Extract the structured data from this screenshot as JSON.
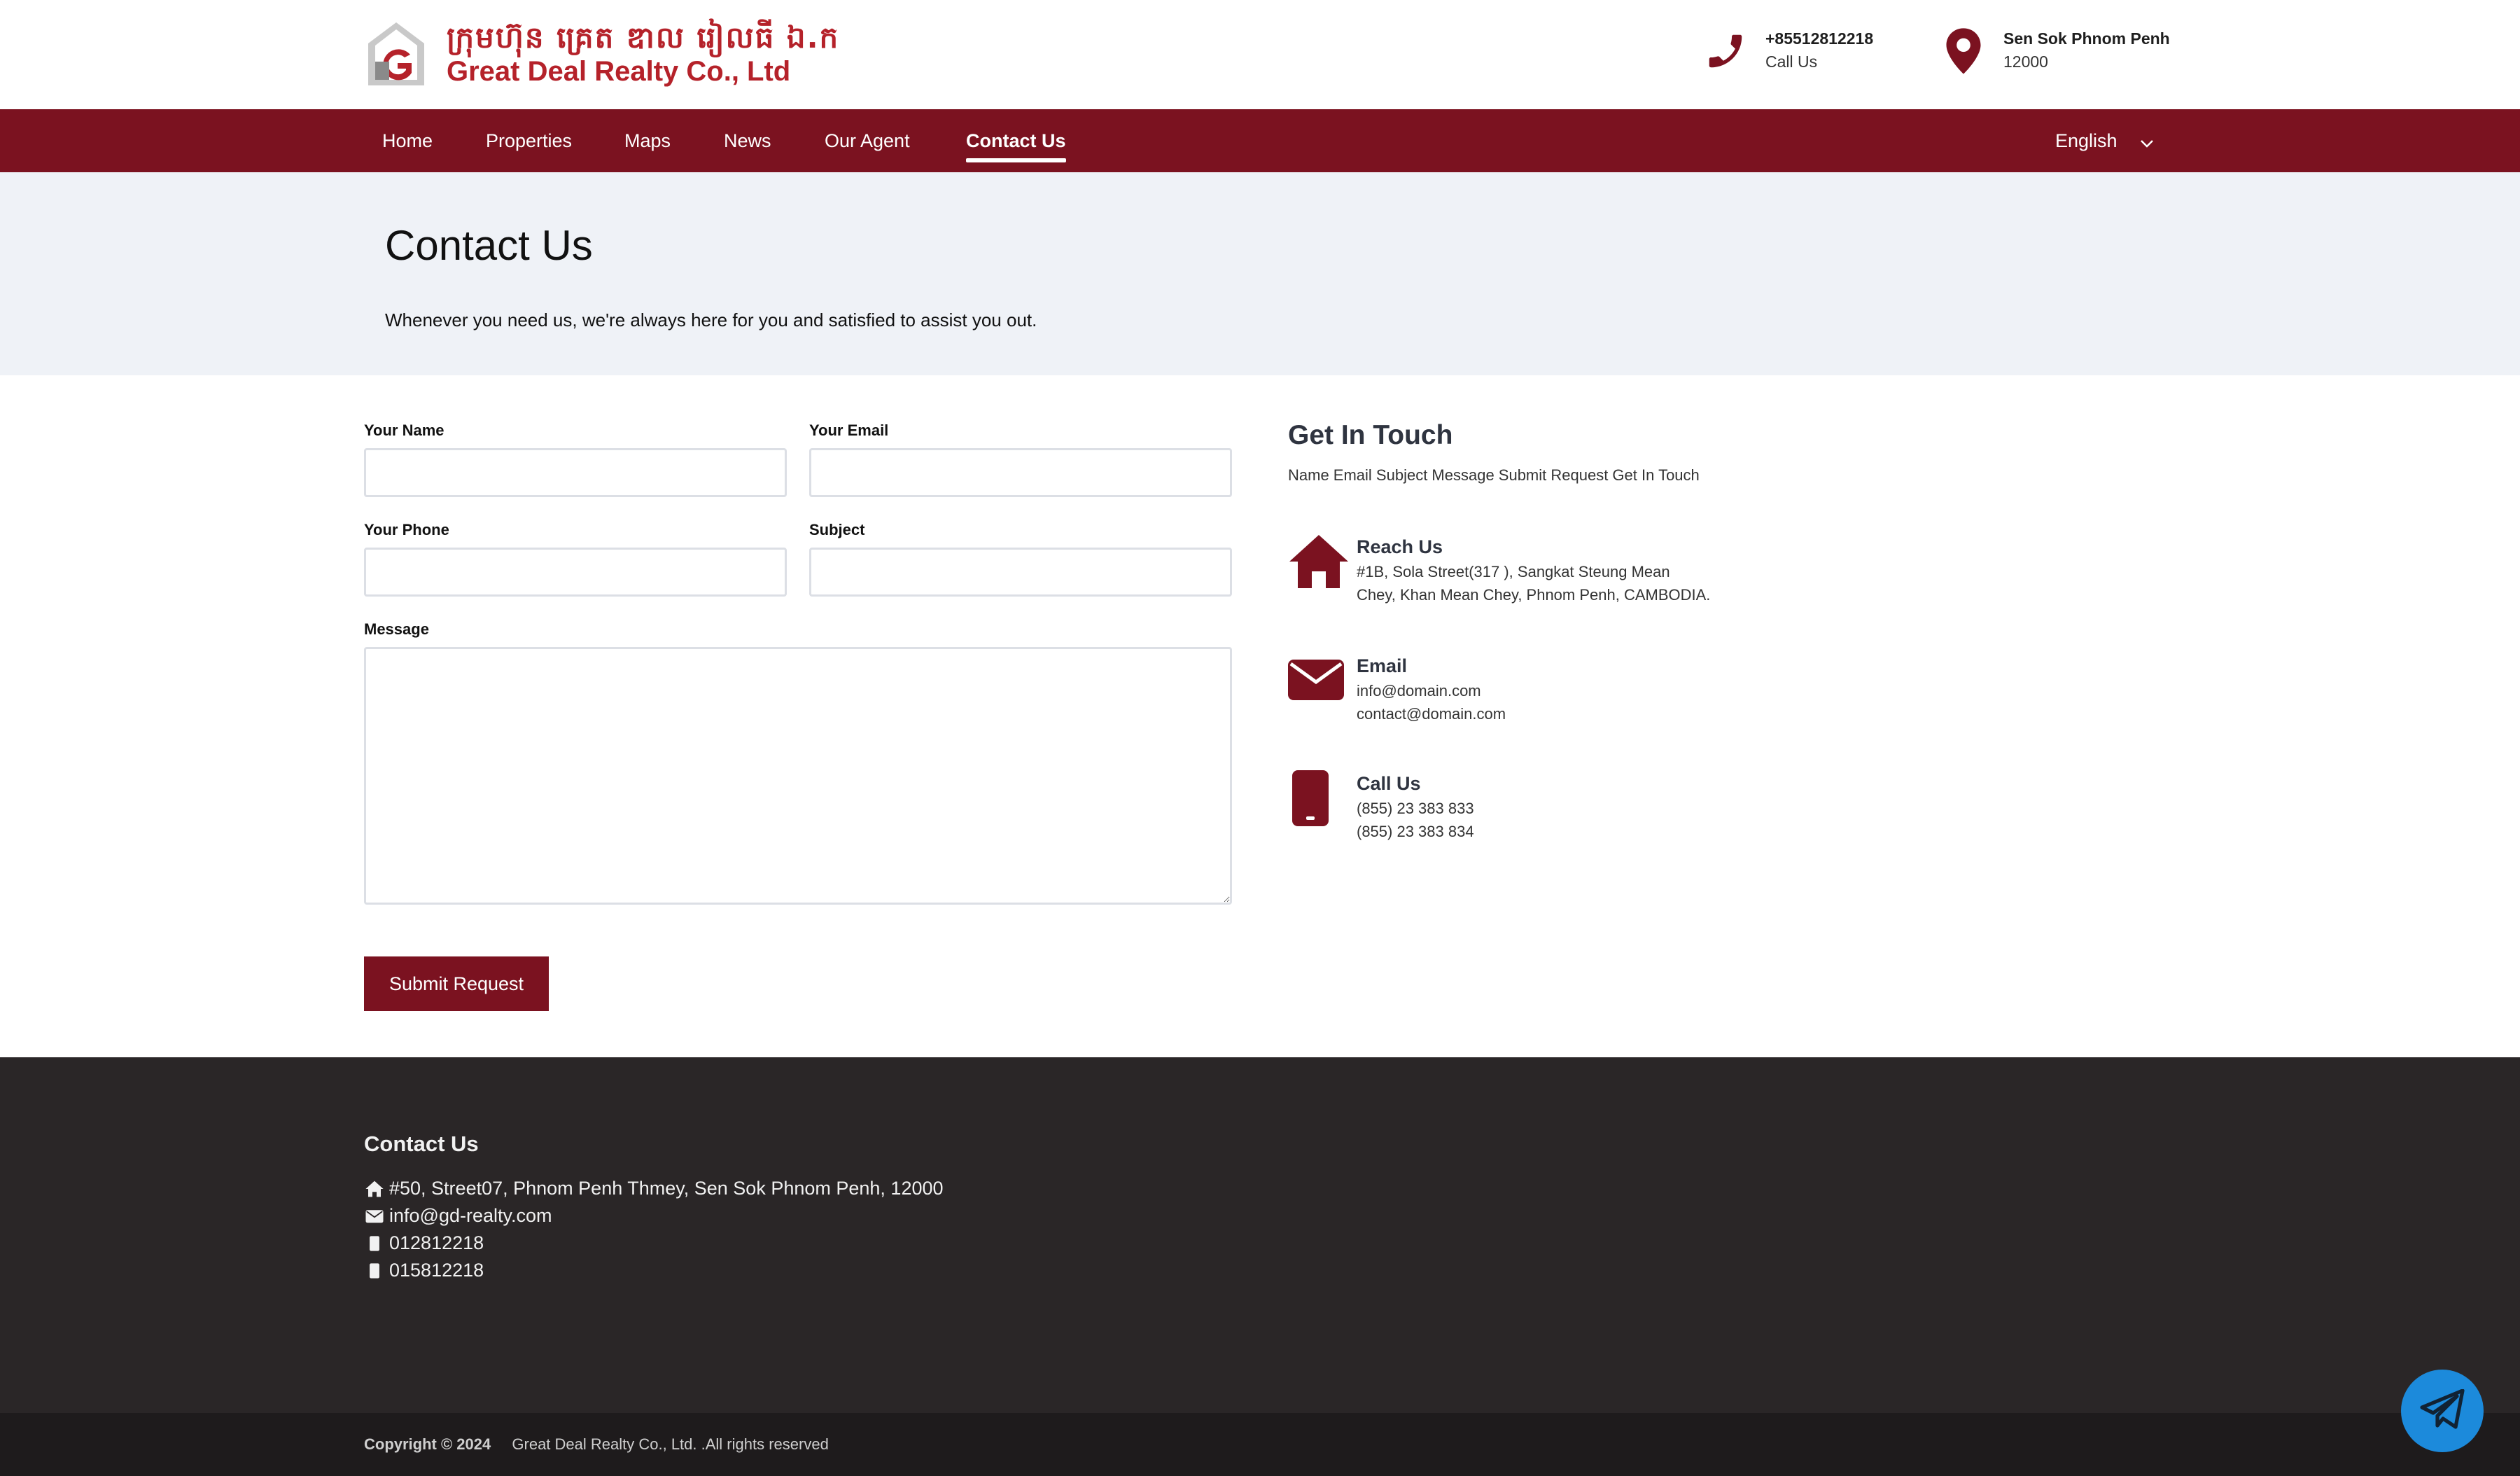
{
  "brand": {
    "name_km": "ក្រុមហ៊ុន គ្រេត ឌាល រៀលធី ឯ.ក",
    "name_en": "Great Deal Realty Co., Ltd",
    "accent": "#7b1220",
    "logo_red": "#b5222a"
  },
  "header_contact": {
    "phone": "+85512812218",
    "phone_caption": "Call Us",
    "location": "Sen Sok Phnom Penh",
    "location_caption": "12000"
  },
  "nav": {
    "items": [
      {
        "label": "Home"
      },
      {
        "label": "Properties"
      },
      {
        "label": "Maps"
      },
      {
        "label": "News"
      },
      {
        "label": "Our Agent"
      },
      {
        "label": "Contact Us"
      }
    ],
    "active": "Contact Us",
    "language": "English"
  },
  "hero": {
    "title": "Contact Us",
    "subtitle": "Whenever you need us, we're always here for you and satisfied to assist you out."
  },
  "form": {
    "name_label": "Your Name",
    "name_value": "",
    "email_label": "Your Email",
    "email_value": "",
    "phone_label": "Your Phone",
    "phone_value": "",
    "subject_label": "Subject",
    "subject_value": "",
    "message_label": "Message",
    "message_value": "",
    "submit_label": "Submit Request"
  },
  "get_in_touch": {
    "title": "Get In Touch",
    "subtitle": "Name Email Subject Message Submit Request Get In Touch",
    "reach_title": "Reach Us",
    "reach_line1": "#1B, Sola Street(317 ), Sangkat Steung Mean",
    "reach_line2": "Chey, Khan Mean Chey, Phnom Penh, CAMBODIA.",
    "email_title": "Email",
    "email_line1": "info@domain.com",
    "email_line2": "contact@domain.com",
    "call_title": "Call Us",
    "call_line1": "(855) 23 383 833",
    "call_line2": "(855) 23 383 834"
  },
  "footer": {
    "title": "Contact Us",
    "address": "#50, Street07, Phnom Penh Thmey, Sen Sok Phnom Penh, 12000",
    "email": "info@gd-realty.com",
    "phone1": "012812218",
    "phone2": "015812218",
    "copyright_label": "Copyright © 2024",
    "copyright_text": "Great Deal Realty Co., Ltd. .All rights reserved"
  },
  "icons": {
    "phone": "phone-icon",
    "location": "map-pin-icon",
    "home": "home-icon",
    "email": "envelope-icon",
    "mobile": "mobile-icon",
    "telegram": "telegram-icon",
    "chevron": "chevron-down-icon"
  }
}
